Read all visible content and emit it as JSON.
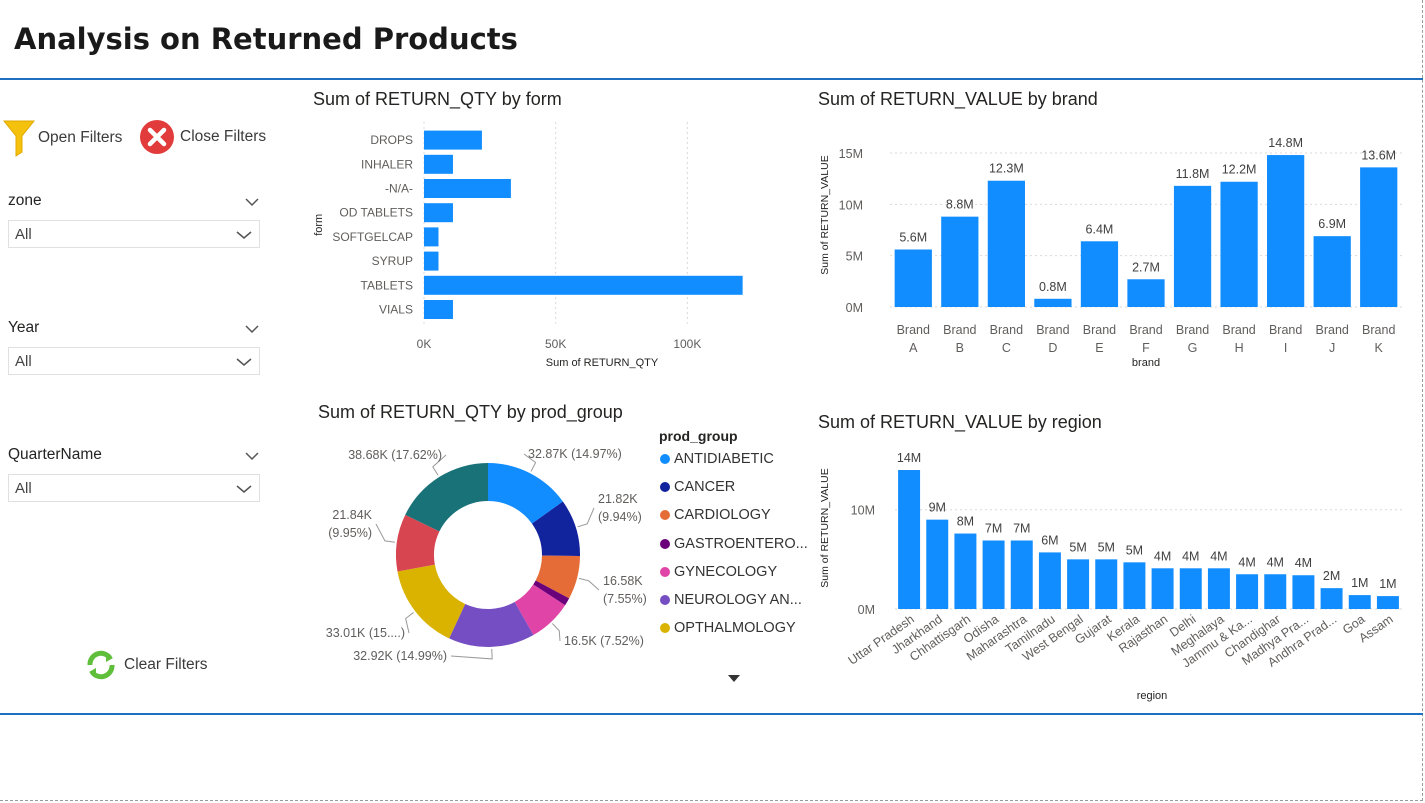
{
  "page_title": "Analysis on Returned Products",
  "filters": {
    "open_label": "Open Filters",
    "close_label": "Close Filters",
    "clear_label": "Clear Filters",
    "slicers": [
      {
        "title": "zone",
        "value": "All"
      },
      {
        "title": "Year",
        "value": "All"
      },
      {
        "title": "QuarterName",
        "value": "All"
      }
    ]
  },
  "colors": {
    "accent": "#118dff",
    "divider": "#1f6fc0",
    "grid": "#d9d9d9"
  },
  "charts": {
    "form": {
      "title": "Sum of RETURN_QTY by form",
      "xlabel": "Sum of RETURN_QTY",
      "ylabel": "form",
      "x_ticks": [
        "0K",
        "50K",
        "100K"
      ]
    },
    "brand": {
      "title": "Sum of RETURN_VALUE by brand",
      "xlabel": "brand",
      "ylabel": "Sum of RETURN_VALUE",
      "y_ticks": [
        "0M",
        "5M",
        "10M",
        "15M"
      ]
    },
    "prod_group": {
      "title": "Sum of RETURN_QTY by prod_group",
      "legend_title": "prod_group"
    },
    "region": {
      "title": "Sum of RETURN_VALUE by region",
      "xlabel": "region",
      "ylabel": "Sum of RETURN_VALUE",
      "y_ticks": [
        "0M",
        "10M"
      ]
    }
  },
  "chart_data": [
    {
      "type": "bar",
      "orientation": "horizontal",
      "title": "Sum of RETURN_QTY by form",
      "xlabel": "Sum of RETURN_QTY",
      "ylabel": "form",
      "xlim": [
        0,
        120000
      ],
      "categories": [
        "DROPS",
        "INHALER",
        "-N/A-",
        "OD TABLETS",
        "SOFTGELCAP",
        "SYRUP",
        "TABLETS",
        "VIALS"
      ],
      "values": [
        22000,
        11000,
        33000,
        11000,
        5500,
        5500,
        121000,
        11000
      ],
      "color": "#118dff",
      "grid": true
    },
    {
      "type": "bar",
      "title": "Sum of RETURN_VALUE by brand",
      "xlabel": "brand",
      "ylabel": "Sum of RETURN_VALUE",
      "ylim": [
        0,
        15
      ],
      "unit": "M",
      "categories": [
        "Brand A",
        "Brand B",
        "Brand C",
        "Brand D",
        "Brand E",
        "Brand F",
        "Brand G",
        "Brand H",
        "Brand I",
        "Brand J",
        "Brand K"
      ],
      "values": [
        5.6,
        8.8,
        12.3,
        0.8,
        6.4,
        2.7,
        11.8,
        12.2,
        14.8,
        6.9,
        13.6
      ],
      "labels": [
        "5.6M",
        "8.8M",
        "12.3M",
        "0.8M",
        "6.4M",
        "2.7M",
        "11.8M",
        "12.2M",
        "14.8M",
        "6.9M",
        "13.6M"
      ],
      "color": "#118dff",
      "grid": true
    },
    {
      "type": "pie",
      "donut": true,
      "title": "Sum of RETURN_QTY by prod_group",
      "legend": "right",
      "slices": [
        {
          "name": "ANTIDIABETIC",
          "value": 32870,
          "label": "32.87K (14.97%)",
          "color": "#118dff"
        },
        {
          "name": "CANCER",
          "value": 21820,
          "label": "21.82K (9.94%)",
          "color": "#12239e"
        },
        {
          "name": "CARDIOLOGY",
          "value": 16580,
          "label": "16.58K (7.55%)",
          "color": "#e66c37"
        },
        {
          "name": "GASTROENTERO...",
          "value": 3000,
          "label": "",
          "color": "#6b007b"
        },
        {
          "name": "GYNECOLOGY",
          "value": 16500,
          "label": "16.5K (7.52%)",
          "color": "#e044a7"
        },
        {
          "name": "NEUROLOGY AN...",
          "value": 32920,
          "label": "32.92K (14.99%)",
          "color": "#744ec2"
        },
        {
          "name": "OPTHALMOLOGY",
          "value": 33010,
          "label": "33.01K (15....)",
          "color": "#d9b300"
        },
        {
          "name": "",
          "value": 21840,
          "label": "21.84K (9.95%)",
          "color": "#d64550"
        },
        {
          "name": "",
          "value": 38680,
          "label": "38.68K (17.62%)",
          "color": "#197278"
        }
      ]
    },
    {
      "type": "bar",
      "title": "Sum of RETURN_VALUE by region",
      "xlabel": "region",
      "ylabel": "Sum of RETURN_VALUE",
      "ylim": [
        0,
        14
      ],
      "unit": "M",
      "categories": [
        "Uttar Pradesh",
        "Jharkhand",
        "Chhattisgarh",
        "Odisha",
        "Maharashtra",
        "Tamilnadu",
        "West Bengal",
        "Gujarat",
        "Kerala",
        "Rajasthan",
        "Delhi",
        "Meghalaya",
        "Jammu & Ka...",
        "Chandighar",
        "Madhya Pra...",
        "Andhra Prad...",
        "Goa",
        "Assam"
      ],
      "values": [
        14.0,
        9.0,
        7.6,
        6.9,
        6.9,
        5.7,
        5.0,
        5.0,
        4.7,
        4.1,
        4.1,
        4.1,
        3.5,
        3.5,
        3.4,
        2.1,
        1.4,
        1.3
      ],
      "labels": [
        "14M",
        "9M",
        "8M",
        "7M",
        "7M",
        "6M",
        "5M",
        "5M",
        "5M",
        "4M",
        "4M",
        "4M",
        "4M",
        "4M",
        "4M",
        "2M",
        "1M",
        "1M"
      ],
      "color": "#118dff",
      "grid": true
    }
  ]
}
